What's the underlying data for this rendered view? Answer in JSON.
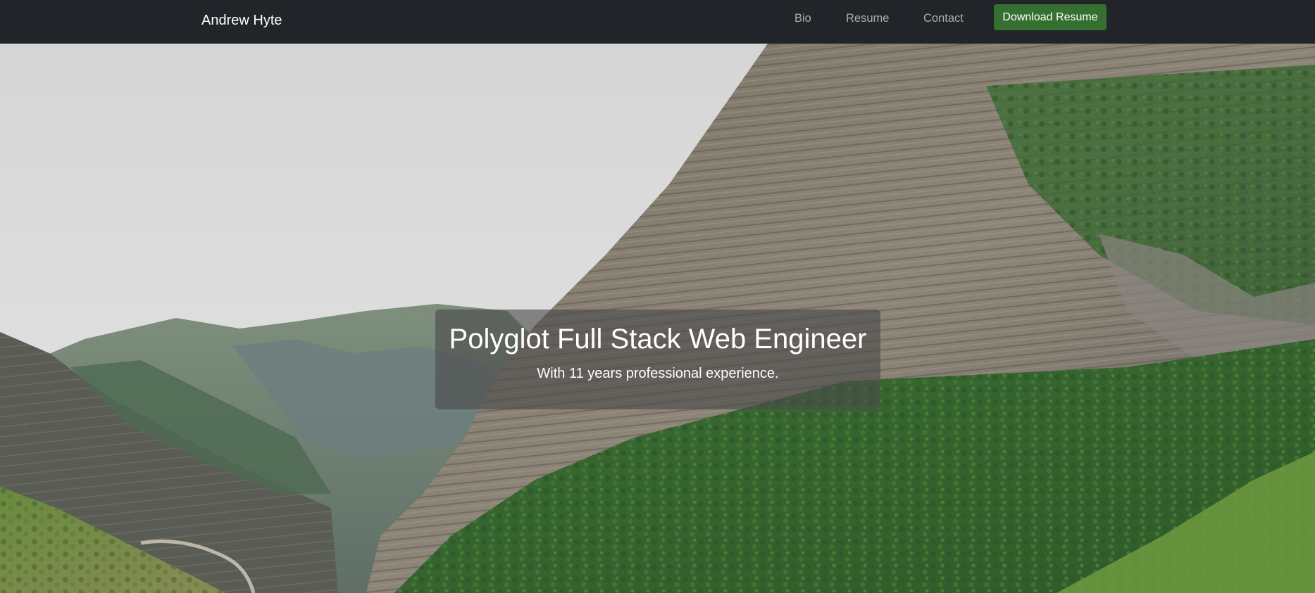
{
  "navbar": {
    "brand": "Andrew Hyte",
    "links": [
      "Bio",
      "Resume",
      "Contact"
    ],
    "download_label": "Download Resume"
  },
  "hero": {
    "image": "mountain-valley-landscape",
    "title": "Polyglot Full Stack Web Engineer",
    "subtitle": "With 11 years professional experience."
  },
  "colors": {
    "navbar_bg": "#212529",
    "download_button": "#367031",
    "sky": "#d4d4d4"
  }
}
